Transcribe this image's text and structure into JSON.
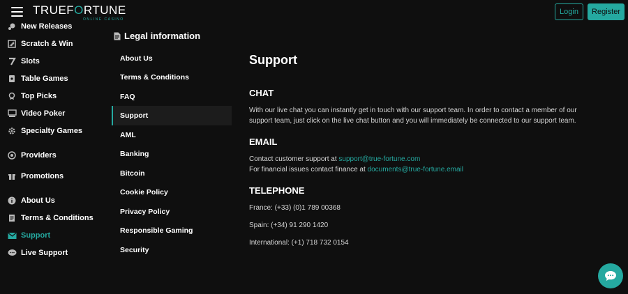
{
  "header": {
    "logo_true": "TRUE",
    "logo_f": "F",
    "logo_o": "O",
    "logo_rtune": "RTUNE",
    "logo_sub": "ONLINE CASINO",
    "login_label": "Login",
    "register_label": "Register"
  },
  "sidebar": {
    "items": [
      {
        "label": "New Releases",
        "icon": "rocket-icon"
      },
      {
        "label": "Scratch & Win",
        "icon": "scratch-icon"
      },
      {
        "label": "Slots",
        "icon": "seven-icon"
      },
      {
        "label": "Table Games",
        "icon": "cards-icon"
      },
      {
        "label": "Top Picks",
        "icon": "award-icon"
      },
      {
        "label": "Video Poker",
        "icon": "video-poker-icon"
      },
      {
        "label": "Specialty Games",
        "icon": "gear-icon"
      },
      {
        "label": "Providers",
        "icon": "chip-icon"
      },
      {
        "label": "Promotions",
        "icon": "gift-icon"
      },
      {
        "label": "About Us",
        "icon": "info-icon"
      },
      {
        "label": "Terms & Conditions",
        "icon": "document-icon"
      },
      {
        "label": "Support",
        "icon": "envelope-icon"
      },
      {
        "label": "Live Support",
        "icon": "chat-bubble-icon"
      }
    ],
    "active": "Support"
  },
  "legal_nav": {
    "title": "Legal information",
    "items": [
      "About Us",
      "Terms & Conditions",
      "FAQ",
      "Support",
      "AML",
      "Banking",
      "Bitcoin",
      "Cookie Policy",
      "Privacy Policy",
      "Responsible Gaming",
      "Security"
    ],
    "active": "Support"
  },
  "content": {
    "title": "Support",
    "chat": {
      "heading": "CHAT",
      "text": "With our live chat you can instantly get in touch with our support team. In order to contact a member of our support team, just click on the live chat button and you will immediately be connected to our support team."
    },
    "email": {
      "heading": "EMAIL",
      "line1_prefix": "Contact customer support at ",
      "line1_link": "support@true-fortune.com",
      "line2_prefix": "For financial issues contact finance at ",
      "line2_link": "documents@true-fortune.email"
    },
    "telephone": {
      "heading": "TELEPHONE",
      "france": "France: (+33) (0)1 789 00368",
      "spain": "Spain: (+34) 91 290 1420",
      "international": "International: (+1) 718 732 0154"
    }
  },
  "colors": {
    "accent": "#25a9a0",
    "background": "#0f0f0f",
    "active_row": "#1c1c1c"
  }
}
